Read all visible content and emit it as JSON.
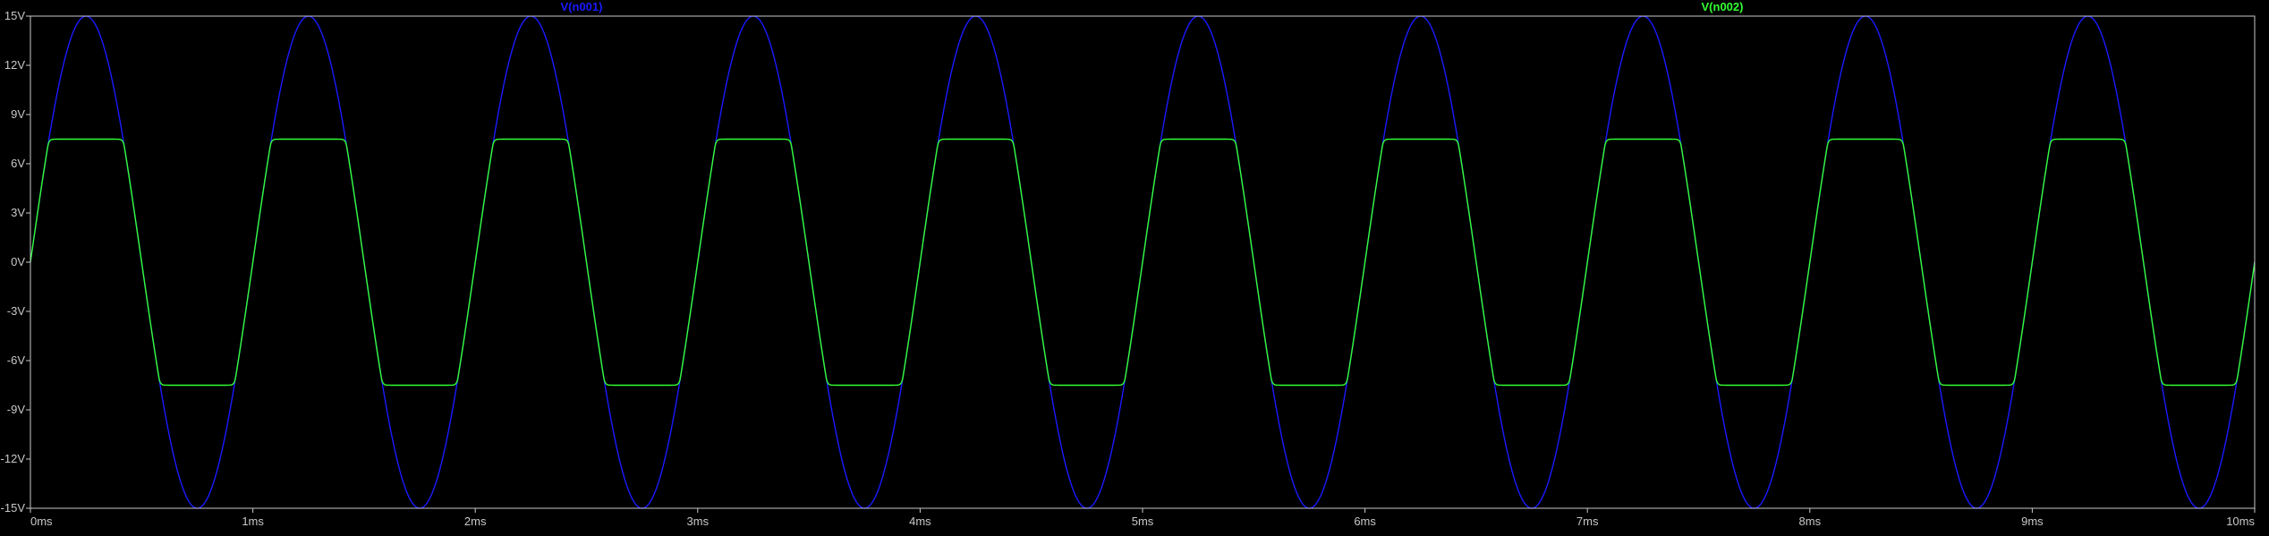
{
  "chart_data": {
    "type": "line",
    "title": "",
    "xlabel": "",
    "ylabel": "",
    "xlim": [
      0,
      10
    ],
    "ylim": [
      -15,
      15
    ],
    "x_unit": "ms",
    "y_unit": "V",
    "grid": false,
    "background_color": "#000000",
    "frame_color": "#c8c8c8",
    "x_ticks": [
      {
        "value": 0,
        "label": "0ms"
      },
      {
        "value": 1,
        "label": "1ms"
      },
      {
        "value": 2,
        "label": "2ms"
      },
      {
        "value": 3,
        "label": "3ms"
      },
      {
        "value": 4,
        "label": "4ms"
      },
      {
        "value": 5,
        "label": "5ms"
      },
      {
        "value": 6,
        "label": "6ms"
      },
      {
        "value": 7,
        "label": "7ms"
      },
      {
        "value": 8,
        "label": "8ms"
      },
      {
        "value": 9,
        "label": "9ms"
      },
      {
        "value": 10,
        "label": "10ms"
      }
    ],
    "y_ticks": [
      {
        "value": 15,
        "label": "15V"
      },
      {
        "value": 12,
        "label": "12V"
      },
      {
        "value": 9,
        "label": "9V"
      },
      {
        "value": 6,
        "label": "6V"
      },
      {
        "value": 3,
        "label": "3V"
      },
      {
        "value": 0,
        "label": "0V"
      },
      {
        "value": -3,
        "label": "-3V"
      },
      {
        "value": -6,
        "label": "-6V"
      },
      {
        "value": -9,
        "label": "-9V"
      },
      {
        "value": -12,
        "label": "-12V"
      },
      {
        "value": -15,
        "label": "-15V"
      }
    ],
    "series": [
      {
        "name": "V(n001)",
        "color": "#1a1aff",
        "waveform": "sine",
        "amplitude": 15,
        "frequency_khz": 1,
        "offset": 0
      },
      {
        "name": "V(n002)",
        "color": "#33ff33",
        "waveform": "clipped-sine",
        "amplitude": 15,
        "frequency_khz": 1,
        "offset": 0,
        "clip_level": 7,
        "clipped_peak": 7.5
      }
    ]
  }
}
